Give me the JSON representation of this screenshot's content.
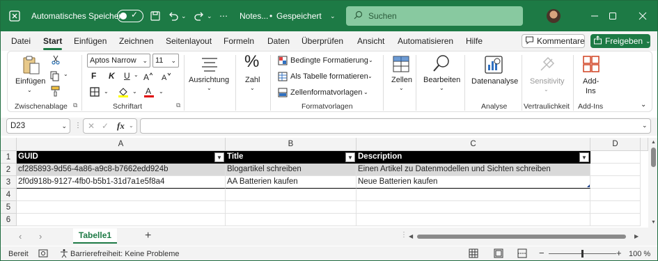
{
  "titlebar": {
    "autosave_label": "Automatisches Speichern",
    "doc_name": "Notes...",
    "separator": "•",
    "saved_status": "Gespeichert",
    "search_placeholder": "Suchen"
  },
  "menu": {
    "tabs": [
      "Datei",
      "Start",
      "Einfügen",
      "Zeichnen",
      "Seitenlayout",
      "Formeln",
      "Daten",
      "Überprüfen",
      "Ansicht",
      "Automatisieren",
      "Hilfe"
    ],
    "active": "Start",
    "comments_label": "Kommentare",
    "share_label": "Freigeben"
  },
  "ribbon": {
    "paste_label": "Einfügen",
    "clipboard_group": "Zwischenablage",
    "font_name": "Aptos Narrow",
    "font_size": "11",
    "bold": "F",
    "italic": "K",
    "underline": "U",
    "font_group": "Schriftart",
    "alignment_label": "Ausrichtung",
    "number_label": "Zahl",
    "cond_format": "Bedingte Formatierung",
    "as_table": "Als Tabelle formatieren",
    "cell_styles": "Zellenformatvorlagen",
    "styles_group": "Formatvorlagen",
    "cells_label": "Zellen",
    "editing_label": "Bearbeiten",
    "data_analysis": "Datenanalyse",
    "analysis_group": "Analyse",
    "sensitivity": "Sensitivity",
    "confidentiality_group": "Vertraulichkeit",
    "addins_line1": "Add-",
    "addins_line2": "Ins",
    "addins_group": "Add-Ins"
  },
  "formula_bar": {
    "name_box": "D23",
    "fx": "fx",
    "formula": ""
  },
  "sheet": {
    "columns": [
      "A",
      "B",
      "C",
      "D"
    ],
    "rows": [
      "1",
      "2",
      "3",
      "4",
      "5",
      "6"
    ],
    "header": [
      "GUID",
      "Title",
      "Description"
    ],
    "data": [
      [
        "cf285893-9d56-4a86-a9c8-b7662edd924b",
        "Blogartikel schreiben",
        "Einen Artikel zu Datenmodellen und Sichten schreiben"
      ],
      [
        "2f0d918b-9127-4fb0-b5b1-31d7a1e5f8a4",
        "AA Batterien kaufen",
        "Neue Batterien kaufen"
      ]
    ]
  },
  "sheet_tabs": {
    "active_tab": "Tabelle1",
    "add": "+"
  },
  "status": {
    "ready": "Bereit",
    "accessibility": "Barrierefreiheit: Keine Probleme",
    "zoom": "100 %"
  },
  "colors": {
    "brand": "#1d7a45",
    "table_header": "#000000",
    "banded_row": "#d9d9d9"
  }
}
